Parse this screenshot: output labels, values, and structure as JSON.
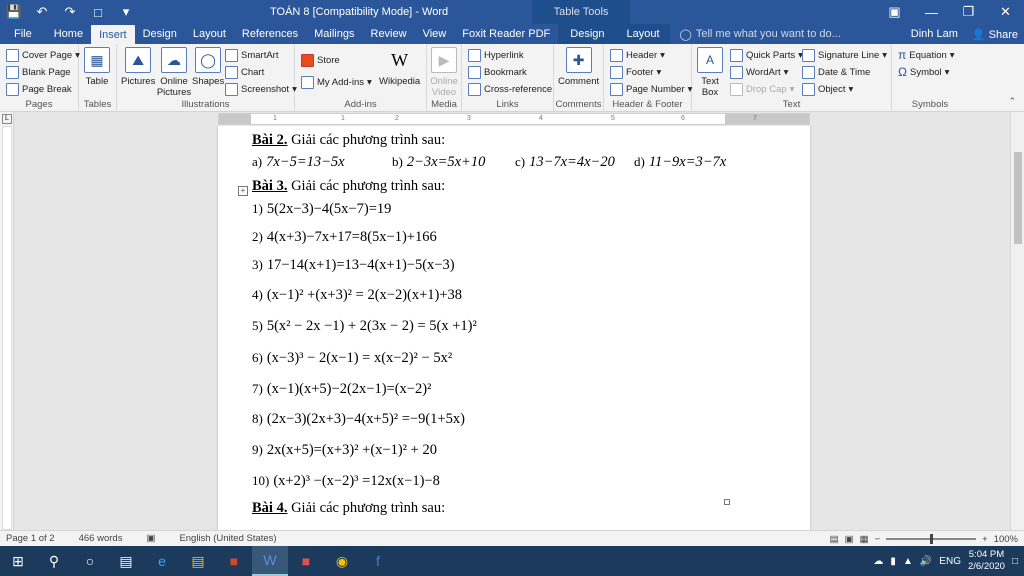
{
  "title": "TOÁN 8 [Compatibility Mode] - Word",
  "table_tools": "Table Tools",
  "tabs": [
    "File",
    "Home",
    "Insert",
    "Design",
    "Layout",
    "References",
    "Mailings",
    "Review",
    "View",
    "Foxit Reader PDF",
    "Design",
    "Layout"
  ],
  "tell_me": "Tell me what you want to do...",
  "user": "Dinh Lam",
  "share": "Share",
  "ribbon": {
    "pages": {
      "label": "Pages",
      "cover": "Cover Page",
      "blank": "Blank Page",
      "break": "Page Break"
    },
    "tables": {
      "label": "Tables",
      "table": "Table"
    },
    "illustrations": {
      "label": "Illustrations",
      "pictures": "Pictures",
      "online_pictures": "Online Pictures",
      "shapes": "Shapes",
      "smartart": "SmartArt",
      "chart": "Chart",
      "screenshot": "Screenshot"
    },
    "addins": {
      "label": "Add-ins",
      "store": "Store",
      "my_addins": "My Add-ins",
      "wikipedia": "Wikipedia"
    },
    "media": {
      "label": "Media",
      "online_video": "Online Video"
    },
    "links": {
      "label": "Links",
      "hyperlink": "Hyperlink",
      "bookmark": "Bookmark",
      "cross": "Cross-reference"
    },
    "comments": {
      "label": "Comments",
      "comment": "Comment"
    },
    "hf": {
      "label": "Header & Footer",
      "header": "Header",
      "footer": "Footer",
      "pagenum": "Page Number"
    },
    "text": {
      "label": "Text",
      "textbox": "Text Box",
      "quickparts": "Quick Parts",
      "wordart": "WordArt",
      "dropcap": "Drop Cap",
      "sigline": "Signature Line",
      "datetime": "Date & Time",
      "object": "Object"
    },
    "symbols": {
      "label": "Symbols",
      "equation": "Equation",
      "symbol": "Symbol"
    }
  },
  "ruler_nums": [
    "1",
    "1",
    "2",
    "3",
    "4",
    "5",
    "6",
    "7"
  ],
  "doc": {
    "bai2_title": "Bài 2.",
    "bai2_text": " Giải các phương trình sau:",
    "bai2": [
      {
        "n": "a)",
        "eq": "7x−5=13−5x"
      },
      {
        "n": "b)",
        "eq": "2−3x=5x+10"
      },
      {
        "n": "c)",
        "eq": "13−7x=4x−20"
      },
      {
        "n": "d)",
        "eq": "11−9x=3−7x"
      }
    ],
    "bai3_title": "Bài 3.",
    "bai3_text": " Giải các phương trình sau:",
    "bai3": [
      {
        "n": "1)",
        "eq": "5(2x−3)−4(5x−7)=19"
      },
      {
        "n": "2)",
        "eq": "4(x+3)−7x+17=8(5x−1)+166"
      },
      {
        "n": "3)",
        "eq": "17−14(x+1)=13−4(x+1)−5(x−3)"
      },
      {
        "n": "4)",
        "eq": "(x−1)² +(x+3)² = 2(x−2)(x+1)+38"
      },
      {
        "n": "5)",
        "eq": "5(x² − 2x −1) + 2(3x − 2) = 5(x +1)²"
      },
      {
        "n": "6)",
        "eq": "(x−3)³ − 2(x−1) = x(x−2)² − 5x²"
      },
      {
        "n": "7)",
        "eq": "(x−1)(x+5)−2(2x−1)=(x−2)²"
      },
      {
        "n": "8)",
        "eq": "(2x−3)(2x+3)−4(x+5)² =−9(1+5x)"
      },
      {
        "n": "9)",
        "eq": "2x(x+5)=(x+3)² +(x−1)² + 20"
      },
      {
        "n": "10)",
        "eq": "(x+2)³ −(x−2)³ =12x(x−1)−8"
      }
    ],
    "bai4_title": "Bài 4.",
    "bai4_text": " Giải các phương trình sau:"
  },
  "status": {
    "page": "Page 1 of 2",
    "words": "466 words",
    "lang": "English (United States)",
    "zoom": "100%"
  },
  "clock": {
    "time": "5:04 PM",
    "date": "2/6/2020"
  },
  "tray": {
    "lang": "ENG"
  }
}
